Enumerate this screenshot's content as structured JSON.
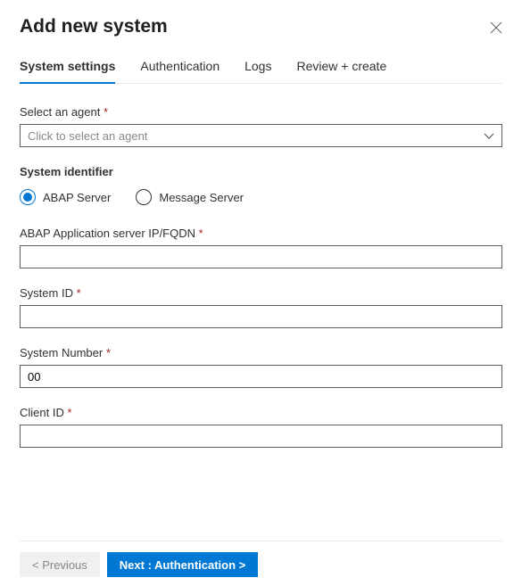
{
  "title": "Add new system",
  "tabs": [
    {
      "label": "System settings",
      "active": true
    },
    {
      "label": "Authentication",
      "active": false
    },
    {
      "label": "Logs",
      "active": false
    },
    {
      "label": "Review + create",
      "active": false
    }
  ],
  "select_agent": {
    "label": "Select an agent",
    "required": "*",
    "placeholder": "Click to select an agent"
  },
  "system_identifier": {
    "heading": "System identifier",
    "options": [
      {
        "label": "ABAP Server",
        "selected": true
      },
      {
        "label": "Message Server",
        "selected": false
      }
    ]
  },
  "fields": {
    "abap_server": {
      "label": "ABAP Application server IP/FQDN",
      "required": "*",
      "value": ""
    },
    "system_id": {
      "label": "System ID",
      "required": "*",
      "value": ""
    },
    "system_number": {
      "label": "System Number",
      "required": "*",
      "value": "00"
    },
    "client_id": {
      "label": "Client ID",
      "required": "*",
      "value": ""
    }
  },
  "footer": {
    "previous": "< Previous",
    "next": "Next : Authentication  >"
  }
}
